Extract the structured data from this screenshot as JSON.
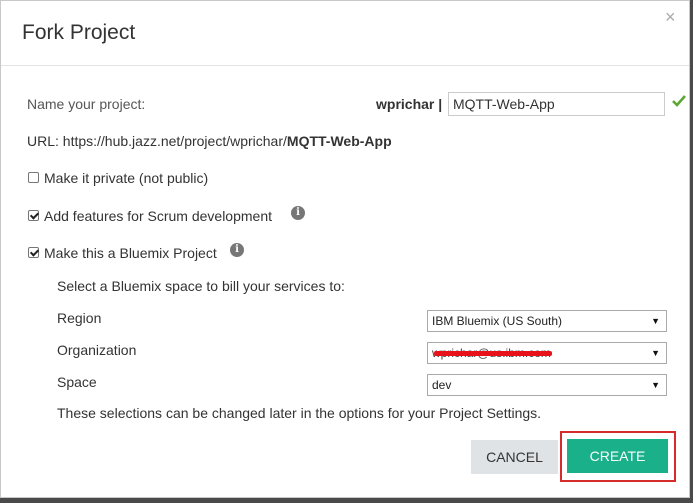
{
  "dialog": {
    "title": "Fork Project",
    "close_glyph": "×",
    "name_label": "Name your project:",
    "owner": "wprichar",
    "owner_sep": "|",
    "project_name": "MQTT-Web-App",
    "url_prefix": "URL: https://hub.jazz.net/project/wprichar/",
    "url_project": "MQTT-Web-App",
    "options": {
      "private": {
        "label": "Make it private (not public)",
        "checked": false
      },
      "scrum": {
        "label": "Add features for Scrum development",
        "checked": true
      },
      "bluemix": {
        "label": "Make this a Bluemix Project",
        "checked": true
      }
    },
    "bluemix": {
      "intro": "Select a Bluemix space to bill your services to:",
      "region_label": "Region",
      "region_value": "IBM Bluemix (US South)",
      "org_label": "Organization",
      "org_value": "wprichar@us.ibm.com",
      "space_label": "Space",
      "space_value": "dev",
      "note": "These selections can be changed later in the options for your Project Settings."
    },
    "buttons": {
      "cancel": "CANCEL",
      "create": "CREATE"
    },
    "icons": {
      "close": "close-icon",
      "valid": "checkmark-icon",
      "info": "info-icon",
      "dropdown": "chevron-down-icon"
    },
    "colors": {
      "create": "#1ab08a",
      "highlight": "#d52b2b",
      "valid": "#5aa832"
    }
  }
}
